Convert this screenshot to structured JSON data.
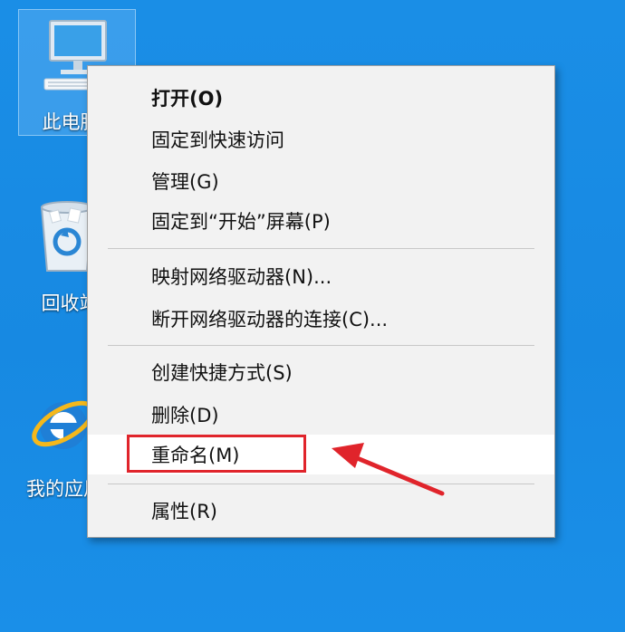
{
  "desktop": {
    "icons": [
      {
        "label": "此电脑",
        "icon": "computer-icon"
      },
      {
        "label": "回收站",
        "icon": "recycle-bin-icon"
      },
      {
        "label": "我的应用",
        "icon": "ie-icon"
      }
    ]
  },
  "context_menu": {
    "items": [
      {
        "label": "打开(O)",
        "bold": true
      },
      {
        "label": "固定到快速访问"
      },
      {
        "label": "管理(G)"
      },
      {
        "label": "固定到“开始”屏幕(P)"
      },
      {
        "label": "映射网络驱动器(N)..."
      },
      {
        "label": "断开网络驱动器的连接(C)..."
      },
      {
        "label": "创建快捷方式(S)"
      },
      {
        "label": "删除(D)"
      },
      {
        "label": "重命名(M)",
        "highlighted": true
      },
      {
        "label": "属性(R)"
      }
    ]
  },
  "annotation": {
    "highlight_color": "#e0242b"
  }
}
